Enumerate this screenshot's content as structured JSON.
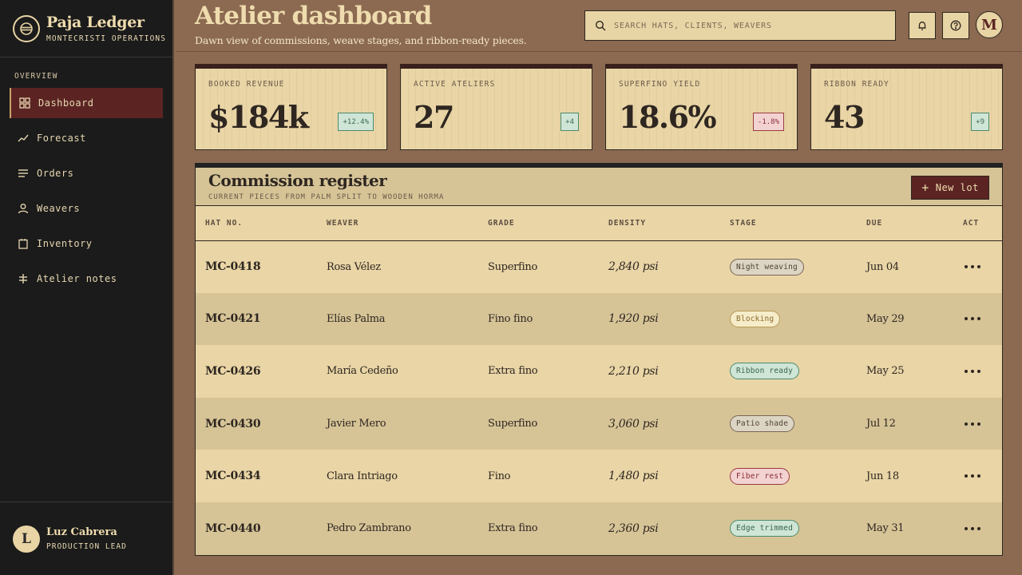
{
  "brand": {
    "name": "Paja Ledger",
    "subtitle": "MONTECRISTI OPERATIONS"
  },
  "sidebar": {
    "section_label": "OVERVIEW",
    "items": [
      {
        "label": "Dashboard",
        "icon": "grid-icon",
        "active": true
      },
      {
        "label": "Forecast",
        "icon": "trend-line-icon"
      },
      {
        "label": "Orders",
        "icon": "list-icon"
      },
      {
        "label": "Weavers",
        "icon": "user-icon"
      },
      {
        "label": "Inventory",
        "icon": "clipboard-icon"
      },
      {
        "label": "Atelier notes",
        "icon": "cross-icon"
      }
    ],
    "user": {
      "initial": "L",
      "name": "Luz Cabrera",
      "role": "PRODUCTION LEAD"
    }
  },
  "header": {
    "title": "Atelier dashboard",
    "subtitle": "Dawn view of commissions, weave stages, and ribbon-ready pieces.",
    "search_placeholder": "SEARCH HATS, CLIENTS, WEAVERS",
    "avatar_initial": "M"
  },
  "kpis": [
    {
      "label": "BOOKED REVENUE",
      "value": "$184k",
      "delta": "+12.4%",
      "trend": "up"
    },
    {
      "label": "ACTIVE ATELIERS",
      "value": "27",
      "delta": "+4",
      "trend": "up"
    },
    {
      "label": "SUPERFINO YIELD",
      "value": "18.6%",
      "delta": "-1.8%",
      "trend": "down"
    },
    {
      "label": "RIBBON READY",
      "value": "43",
      "delta": "+9",
      "trend": "up"
    }
  ],
  "register": {
    "title": "Commission register",
    "subtitle": "CURRENT PIECES FROM PALM SPLIT TO WOODEN HORMA",
    "new_button": "New lot",
    "columns": [
      "HAT NO.",
      "WEAVER",
      "GRADE",
      "DENSITY",
      "STAGE",
      "DUE",
      "ACT"
    ],
    "rows": [
      {
        "hat": "MC-0418",
        "weaver": "Rosa Vélez",
        "grade": "Superfino",
        "density": "2,840 psi",
        "stage": "Night weaving",
        "tone": "neutral",
        "due": "Jun 04"
      },
      {
        "hat": "MC-0421",
        "weaver": "Elías Palma",
        "grade": "Fino fino",
        "density": "1,920 psi",
        "stage": "Blocking",
        "tone": "amber",
        "due": "May 29"
      },
      {
        "hat": "MC-0426",
        "weaver": "María Cedeño",
        "grade": "Extra fino",
        "density": "2,210 psi",
        "stage": "Ribbon ready",
        "tone": "green",
        "due": "May 25"
      },
      {
        "hat": "MC-0430",
        "weaver": "Javier Mero",
        "grade": "Superfino",
        "density": "3,060 psi",
        "stage": "Patio shade",
        "tone": "neutral",
        "due": "Jul 12"
      },
      {
        "hat": "MC-0434",
        "weaver": "Clara Intriago",
        "grade": "Fino",
        "density": "1,480 psi",
        "stage": "Fiber rest",
        "tone": "red",
        "due": "Jun 18"
      },
      {
        "hat": "MC-0440",
        "weaver": "Pedro Zambrano",
        "grade": "Extra fino",
        "density": "2,360 psi",
        "stage": "Edge trimmed",
        "tone": "green",
        "due": "May 31"
      }
    ]
  },
  "colors": {
    "background": "#8b6a51",
    "sidebar": "#1b1b1b",
    "accent": "#5b2423",
    "card": "#e9d5a6",
    "positive": "#4d8a6e",
    "negative": "#9c3a42"
  }
}
